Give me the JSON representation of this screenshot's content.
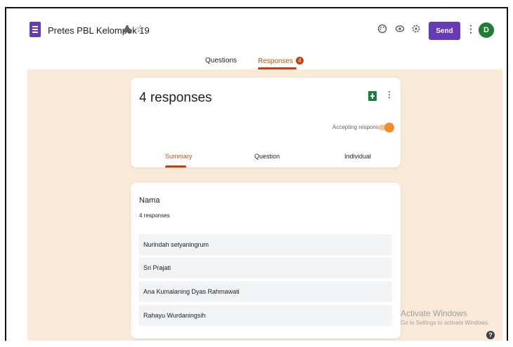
{
  "header": {
    "doc_title": "Pretes PBL Kelompok 19",
    "send_label": "Send",
    "avatar_initial": "D",
    "icons": [
      "move-to-folder-icon",
      "star-icon",
      "palette-icon",
      "preview-icon",
      "settings-icon",
      "more-vert-icon"
    ]
  },
  "tabs": {
    "questions_label": "Questions",
    "responses_label": "Responses",
    "responses_badge": "4"
  },
  "summary": {
    "response_count": "4 responses",
    "accepting_label": "Accepting responses",
    "accepting": true,
    "subtabs": [
      "Summary",
      "Question",
      "Individual"
    ]
  },
  "question": {
    "title": "Nama",
    "subtitle": "4 responses",
    "answers": [
      "Nurindah setyaningrum",
      "Sri Prajati",
      "Ana Kumalaning Dyas Rahmawati",
      "Rahayu Wurdaningsih"
    ]
  },
  "watermark": {
    "line1": "Activate Windows",
    "line2": "Go to Settings to activate Windows."
  },
  "colors": {
    "brand": "#673ab7",
    "accent": "#c2410c",
    "background": "#fbe9d8"
  }
}
